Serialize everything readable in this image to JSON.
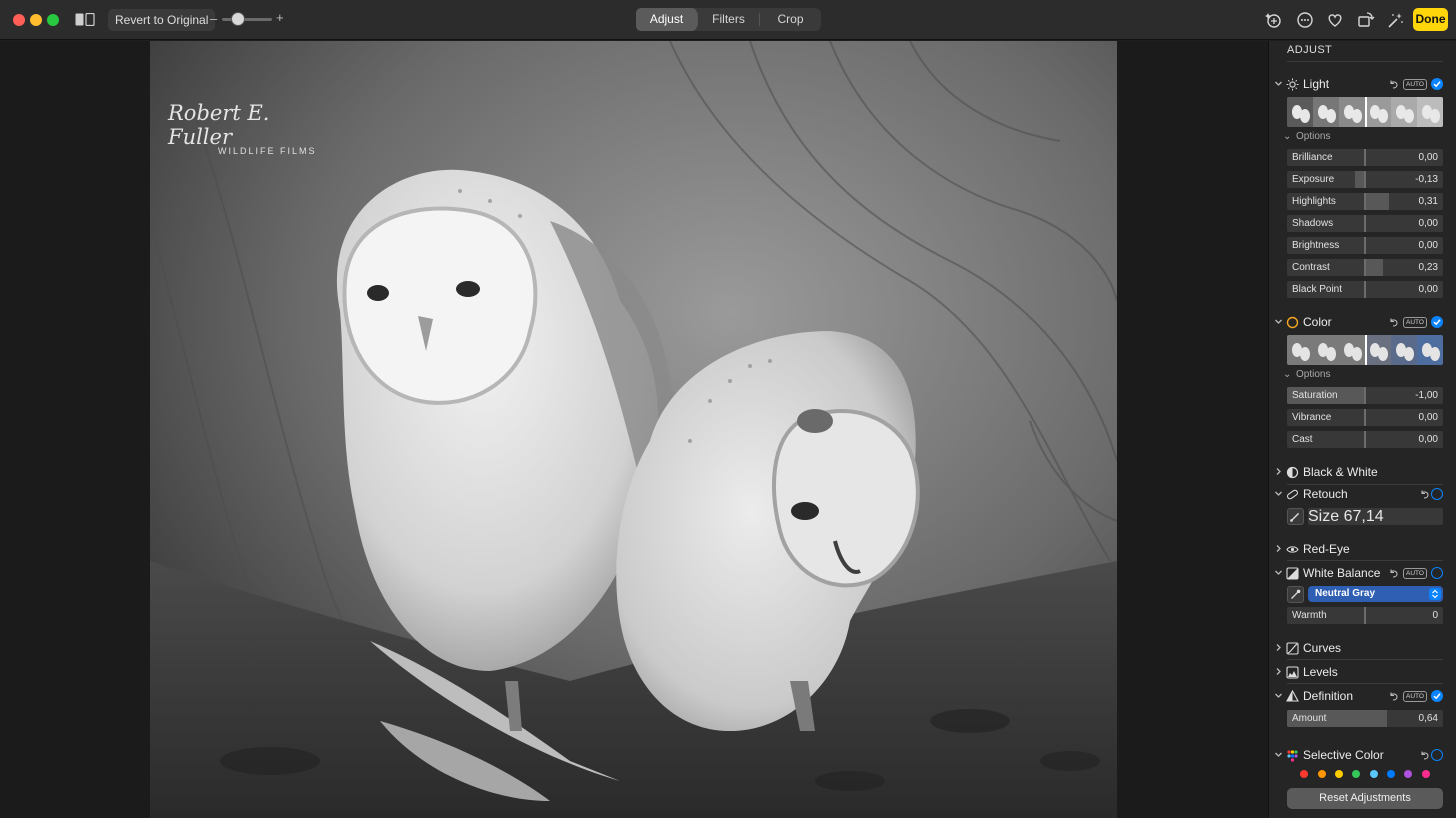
{
  "toolbar": {
    "revert_label": "Revert to Original",
    "zoom_minus": "–",
    "zoom_plus": "+",
    "zoom_level": 0.2,
    "tabs": [
      {
        "label": "Adjust",
        "active": true
      },
      {
        "label": "Filters",
        "active": false
      },
      {
        "label": "Crop",
        "active": false
      }
    ],
    "done_label": "Done",
    "right_icons": [
      "auto-enhance-icon",
      "more-icon",
      "favorite-icon",
      "rotate-icon",
      "magic-wand-icon"
    ]
  },
  "photo": {
    "watermark_name": "Robert E. Fuller",
    "watermark_sub": "WILDLIFE FILMS"
  },
  "sidebar": {
    "title": "ADJUST",
    "light": {
      "name": "Light",
      "auto": "AUTO",
      "options_label": "Options",
      "sliders": [
        {
          "label": "Brilliance",
          "value": "0,00",
          "amount": 0.0
        },
        {
          "label": "Exposure",
          "value": "-0,13",
          "amount": -0.13
        },
        {
          "label": "Highlights",
          "value": "0,31",
          "amount": 0.31
        },
        {
          "label": "Shadows",
          "value": "0,00",
          "amount": 0.0
        },
        {
          "label": "Brightness",
          "value": "0,00",
          "amount": 0.0
        },
        {
          "label": "Contrast",
          "value": "0,23",
          "amount": 0.23
        },
        {
          "label": "Black Point",
          "value": "0,00",
          "amount": 0.0
        }
      ]
    },
    "color": {
      "name": "Color",
      "auto": "AUTO",
      "options_label": "Options",
      "sliders": [
        {
          "label": "Saturation",
          "value": "-1,00",
          "amount": -1.0
        },
        {
          "label": "Vibrance",
          "value": "0,00",
          "amount": 0.0
        },
        {
          "label": "Cast",
          "value": "0,00",
          "amount": 0.0
        }
      ]
    },
    "black_white": {
      "name": "Black & White"
    },
    "retouch": {
      "name": "Retouch",
      "size_label": "Size",
      "size_value": "67,14",
      "size_amount": 0.2
    },
    "red_eye": {
      "name": "Red-Eye"
    },
    "white_balance": {
      "name": "White Balance",
      "auto": "AUTO",
      "mode": "Neutral Gray",
      "warmth_label": "Warmth",
      "warmth_value": "0",
      "warmth_amount": 0.0
    },
    "curves": {
      "name": "Curves"
    },
    "levels": {
      "name": "Levels"
    },
    "definition": {
      "name": "Definition",
      "auto": "AUTO",
      "amount_label": "Amount",
      "amount_value": "0,64",
      "amount": 0.64
    },
    "selective_color": {
      "name": "Selective Color",
      "swatch_colors": [
        "#ff3b30",
        "#ff9500",
        "#ffcc00",
        "#34c759",
        "#5ac8fa",
        "#007aff",
        "#af52de",
        "#ff2d92"
      ]
    },
    "reset_label": "Reset Adjustments",
    "accent_color": "#0a84ff",
    "done_color": "#ffd60a"
  }
}
